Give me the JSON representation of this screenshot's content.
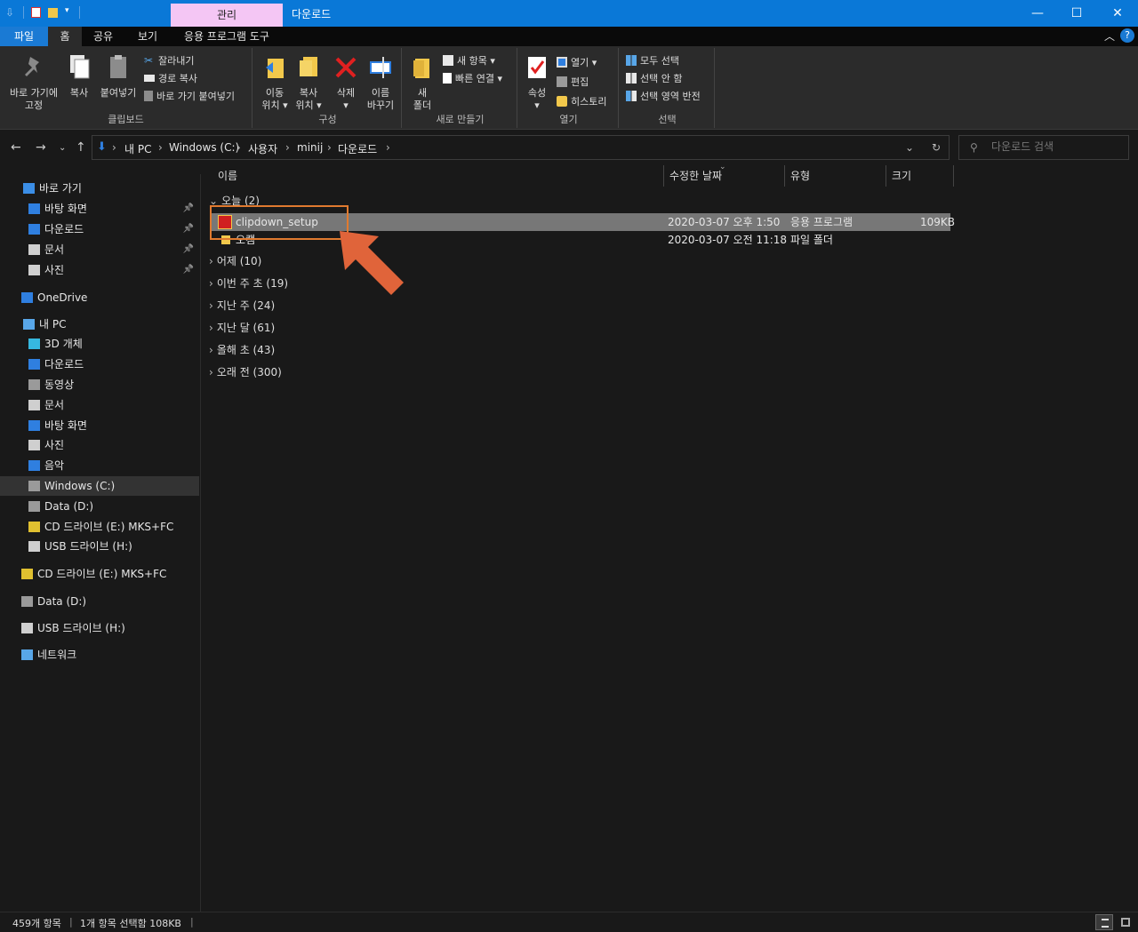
{
  "title": {
    "manage_tab": "관리",
    "window_title": "다운로드"
  },
  "tabs": [
    {
      "label": "파일"
    },
    {
      "label": "홈"
    },
    {
      "label": "공유"
    },
    {
      "label": "보기"
    },
    {
      "label": "응용 프로그램 도구"
    }
  ],
  "ribbon": {
    "clipboard": {
      "label": "클립보드",
      "pin_line1": "바로 가기에",
      "pin_line2": "고정",
      "copy": "복사",
      "paste": "붙여넣기",
      "cut": "잘라내기",
      "copy_path": "경로 복사",
      "paste_shortcut": "바로 가기 붙여넣기"
    },
    "organize": {
      "label": "구성",
      "move_line1": "이동",
      "move_line2": "위치 ▾",
      "copyto_line1": "복사",
      "copyto_line2": "위치 ▾",
      "delete": "삭제",
      "delete_caret": "▾",
      "rename_line1": "이름",
      "rename_line2": "바꾸기"
    },
    "new": {
      "label": "새로 만들기",
      "folder_line1": "새",
      "folder_line2": "폴더",
      "new_item": "새 항목 ▾",
      "easy_access": "빠른 연결 ▾"
    },
    "open": {
      "label": "열기",
      "properties": "속성",
      "properties_caret": "▾",
      "open": "열기 ▾",
      "edit": "편집",
      "history": "히스토리"
    },
    "select": {
      "label": "선택",
      "select_all": "모두 선택",
      "select_none": "선택 안 함",
      "invert": "선택 영역 반전"
    }
  },
  "address": {
    "crumbs": [
      "내 PC",
      "Windows (C:)",
      "사용자",
      "minij",
      "다운로드"
    ],
    "search_placeholder": "다운로드 검색"
  },
  "sidebar": {
    "items": [
      {
        "label": "바로 가기",
        "icon": "star-icon",
        "color": "#3b8ee6"
      },
      {
        "label": "바탕 화면",
        "icon": "desktop-icon",
        "color": "#2f7fe0"
      },
      {
        "label": "다운로드",
        "icon": "download-icon",
        "color": "#2f7fe0"
      },
      {
        "label": "문서",
        "icon": "document-icon",
        "color": "#cfcfcf"
      },
      {
        "label": "사진",
        "icon": "pictures-icon",
        "color": "#cfcfcf"
      },
      {
        "label": "OneDrive",
        "icon": "cloud-icon",
        "color": "#2f7fe0"
      },
      {
        "label": "내 PC",
        "icon": "pc-icon",
        "color": "#58a6e8"
      },
      {
        "label": "3D 개체",
        "icon": "cube-icon",
        "color": "#36b8e0"
      },
      {
        "label": "다운로드",
        "icon": "download-icon",
        "color": "#2f7fe0"
      },
      {
        "label": "동영상",
        "icon": "video-icon",
        "color": "#9a9a9a"
      },
      {
        "label": "문서",
        "icon": "document-icon",
        "color": "#cfcfcf"
      },
      {
        "label": "바탕 화면",
        "icon": "desktop-icon",
        "color": "#2f7fe0"
      },
      {
        "label": "사진",
        "icon": "pictures-icon",
        "color": "#cfcfcf"
      },
      {
        "label": "음악",
        "icon": "music-icon",
        "color": "#2f7fe0"
      },
      {
        "label": "Windows (C:)",
        "icon": "drive-icon",
        "color": "#9a9a9a"
      },
      {
        "label": "Data (D:)",
        "icon": "drive-icon",
        "color": "#9a9a9a"
      },
      {
        "label": "CD 드라이브 (E:) MKS+FC",
        "icon": "cd-icon",
        "color": "#e0c030"
      },
      {
        "label": "USB 드라이브 (H:)",
        "icon": "usb-icon",
        "color": "#cfcfcf"
      },
      {
        "label": "CD 드라이브 (E:) MKS+FC",
        "icon": "cd-icon",
        "color": "#e0c030"
      },
      {
        "label": "Data (D:)",
        "icon": "drive-icon",
        "color": "#9a9a9a"
      },
      {
        "label": "USB 드라이브 (H:)",
        "icon": "usb-icon",
        "color": "#cfcfcf"
      },
      {
        "label": "네트워크",
        "icon": "network-icon",
        "color": "#58a6e8"
      }
    ]
  },
  "columns": {
    "name": "이름",
    "date": "수정한 날짜",
    "type": "유형",
    "size": "크기"
  },
  "groups": {
    "today": "오늘 (2)",
    "yesterday": "어제 (10)",
    "this_week": "이번 주 초 (19)",
    "last_week": "지난 주 (24)",
    "last_month": "지난 달 (61)",
    "this_year": "올해 초 (43)",
    "long_ago": "오래 전 (300)"
  },
  "files": [
    {
      "name": "clipdown_setup",
      "date": "2020-03-07 오후 1:50",
      "type": "응용 프로그램",
      "size": "109KB"
    },
    {
      "name": "오캠",
      "date": "2020-03-07 오전 11:18",
      "type": "파일 폴더",
      "size": ""
    }
  ],
  "status": {
    "count": "459개 항목",
    "selection": "1개 항목 선택함 108KB"
  },
  "colors": {
    "accent": "#0a78d7",
    "highlight": "#e07a2f"
  }
}
